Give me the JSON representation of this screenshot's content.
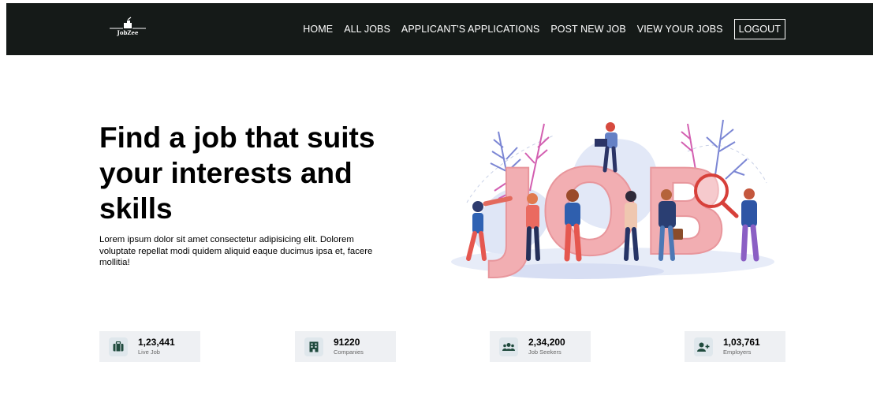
{
  "brand": {
    "name": "JobZee"
  },
  "nav": {
    "items": [
      {
        "label": "HOME"
      },
      {
        "label": "ALL JOBS"
      },
      {
        "label": "APPLICANT'S APPLICATIONS"
      },
      {
        "label": "POST NEW JOB"
      },
      {
        "label": "VIEW YOUR JOBS"
      }
    ],
    "logout_label": "LOGOUT"
  },
  "hero": {
    "title": "Find a job that suits your interests and skills",
    "description": "Lorem ipsum dolor sit amet consectetur adipisicing elit. Dolorem voluptate repellat modi quidem aliquid eaque ducimus ipsa et, facere mollitia!"
  },
  "illustration": {
    "word": "JOB"
  },
  "stats": [
    {
      "value": "1,23,441",
      "label": "Live Job",
      "icon": "briefcase-icon"
    },
    {
      "value": "91220",
      "label": "Companies",
      "icon": "building-icon"
    },
    {
      "value": "2,34,200",
      "label": "Job Seekers",
      "icon": "users-icon"
    },
    {
      "value": "1,03,761",
      "label": "Employers",
      "icon": "user-plus-icon"
    }
  ],
  "colors": {
    "navbar_bg": "#151a18",
    "accent": "#1f4a3d",
    "card_bg": "#eef0f3",
    "job_letters": "#f2aeb2"
  }
}
